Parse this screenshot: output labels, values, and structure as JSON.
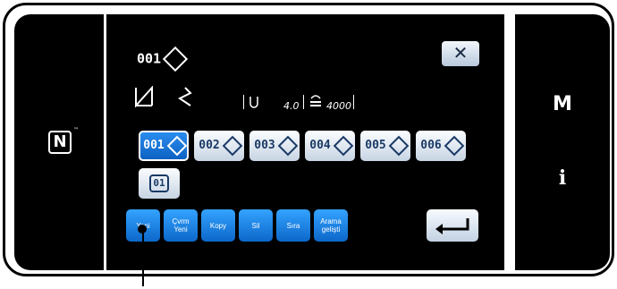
{
  "brand": {
    "nfc_logo": "N",
    "nfc_tm": "™"
  },
  "header": {
    "pattern_label": "001"
  },
  "info": {
    "stitch_type_icon": "zigzag-stitch-icon",
    "stitch_pattern_icon": "curve-stitch-icon",
    "thread_tension_icon": "thread-tension-icon",
    "stitch_length": "4.0",
    "speed_icon": "speed-icon",
    "speed_value": "4000"
  },
  "close_label": "✕",
  "patterns": [
    {
      "label": "001",
      "selected": true
    },
    {
      "label": "002",
      "selected": false
    },
    {
      "label": "003",
      "selected": false
    },
    {
      "label": "004",
      "selected": false
    },
    {
      "label": "005",
      "selected": false
    },
    {
      "label": "006",
      "selected": false
    }
  ],
  "rotate_label": "01",
  "actions": [
    {
      "line1": "Yeni",
      "line2": ""
    },
    {
      "line1": "Çvrm",
      "line2": "Yeni"
    },
    {
      "line1": "Kopy",
      "line2": ""
    },
    {
      "line1": "Sil",
      "line2": ""
    },
    {
      "line1": "Sıra",
      "line2": ""
    },
    {
      "line1": "Arama",
      "line2": "gelişti"
    }
  ],
  "right_panel": {
    "m_label": "M",
    "info_label": "i"
  },
  "colors": {
    "selected_blue": "#0b5fbf",
    "action_blue": "#1f8cf0",
    "screen": "#000000"
  }
}
